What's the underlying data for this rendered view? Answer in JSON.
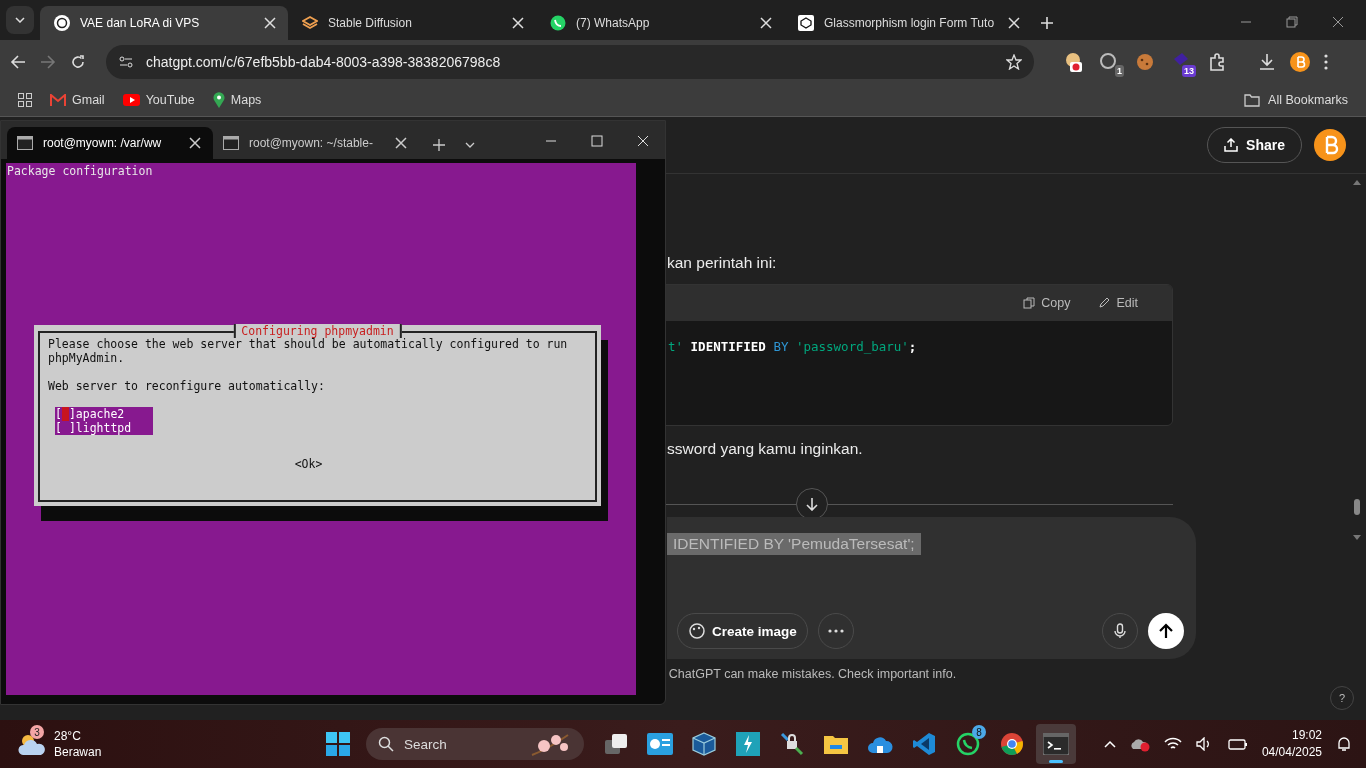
{
  "browser": {
    "tabs": [
      {
        "title": "VAE dan LoRA di VPS",
        "selected": true,
        "kind": "chat"
      },
      {
        "title": "Stable Diffusion",
        "selected": false,
        "kind": "layers"
      },
      {
        "title": "(7) WhatsApp",
        "selected": false,
        "kind": "whatsapp"
      },
      {
        "title": "Glassmorphism login Form Tuto",
        "selected": false,
        "kind": "code"
      }
    ],
    "url": "chatgpt.com/c/67efb5bb-dab4-8003-a398-3838206798c8",
    "extensions": [
      {
        "kind": "blocker"
      },
      {
        "kind": "globe",
        "badge": "1"
      },
      {
        "kind": "cookie"
      },
      {
        "kind": "shape",
        "badge": "13"
      },
      {
        "kind": "puzzle"
      }
    ],
    "bookmarks": [
      {
        "label": "Gmail",
        "kind": "mail"
      },
      {
        "label": "YouTube",
        "kind": "video"
      },
      {
        "label": "Maps",
        "kind": "pin"
      }
    ],
    "all_bookmarks": "All Bookmarks"
  },
  "terminal": {
    "tabs": [
      {
        "title": "root@myown: /var/ww",
        "selected": true
      },
      {
        "title": "root@myown: ~/stable-",
        "selected": false
      }
    ],
    "header": "Package configuration",
    "dialog": {
      "title": "Configuring phpmyadmin",
      "message": [
        "Please choose the web server that should be automatically configured to run",
        "phpMyAdmin."
      ],
      "prompt": "Web server to reconfigure automatically:",
      "options": [
        {
          "open": "[",
          "close": "]",
          "label": "apache2",
          "checked": false,
          "focused": true
        },
        {
          "open": "[",
          "close": "]",
          "label": "lighttpd",
          "checked": false,
          "focused": false
        }
      ],
      "ok": "<Ok>"
    }
  },
  "chat": {
    "share": "Share",
    "intro": "kan perintah ini:",
    "code": {
      "actions": [
        "Copy",
        "Edit"
      ],
      "tokens": [
        {
          "text": "t'",
          "kind": "string"
        },
        {
          "text": " IDENTIFIED ",
          "kind": "plain"
        },
        {
          "text": "BY",
          "kind": "keyword"
        },
        {
          "text": " 'password_baru'",
          "kind": "string"
        },
        {
          "text": ";",
          "kind": "plain"
        }
      ]
    },
    "after": "ssword yang kamu inginkan.",
    "composer": {
      "value": "IDENTIFIED BY 'PemudaTersesat';",
      "tool": "Create image"
    },
    "disclaimer": "ChatGPT can make mistakes. Check important info.",
    "help": "?"
  },
  "taskbar": {
    "weather": {
      "badge": "3",
      "temperature": "28°C",
      "condition": "Berawan"
    },
    "search": "Search",
    "apps": [
      {
        "kind": "taskview",
        "selected": false
      },
      {
        "kind": "slides",
        "selected": false
      },
      {
        "kind": "cube",
        "selected": false
      },
      {
        "kind": "bolt",
        "selected": false
      },
      {
        "kind": "lock",
        "selected": false
      },
      {
        "kind": "folder",
        "selected": false
      },
      {
        "kind": "cloud",
        "selected": false
      },
      {
        "kind": "vscode",
        "selected": false
      },
      {
        "kind": "whatsapp",
        "selected": false,
        "badge": "8"
      },
      {
        "kind": "chrome",
        "selected": false
      },
      {
        "kind": "terminal",
        "selected": true
      }
    ],
    "time": "19:02",
    "date": "04/04/2025"
  }
}
